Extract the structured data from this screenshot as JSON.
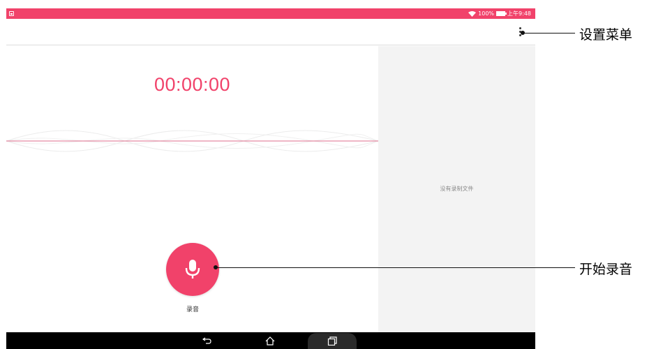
{
  "status_bar": {
    "battery_text": "100%",
    "time": "上午9:48"
  },
  "recorder": {
    "timer": "00:00:00",
    "record_label": "录音",
    "empty_list_text": "没有录制文件"
  },
  "navigation": {
    "buttons": [
      "back-icon",
      "home-icon",
      "recent-apps-icon"
    ]
  },
  "annotations": {
    "menu": "设置菜单",
    "record": "开始录音"
  },
  "colors": {
    "accent": "#f1426a",
    "nav_bar": "#000000",
    "list_background": "#f3f3f3"
  }
}
